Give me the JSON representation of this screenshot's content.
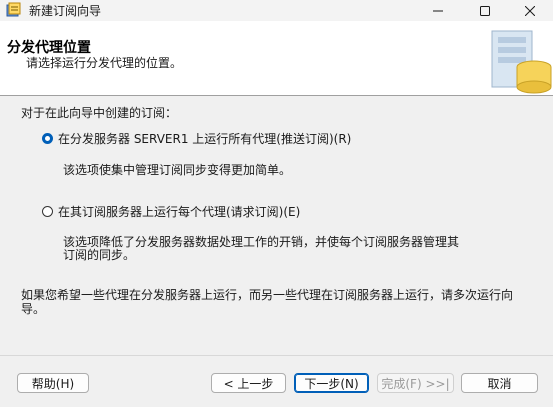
{
  "window": {
    "title": "新建订阅向导"
  },
  "header": {
    "title": "分发代理位置",
    "subtitle": "请选择运行分发代理的位置。"
  },
  "main": {
    "section_label": "对于在此向导中创建的订阅：",
    "options": [
      {
        "label": "在分发服务器 SERVER1 上运行所有代理(推送订阅)(R)",
        "checked": true,
        "description": "该选项使集中管理订阅同步变得更加简单。"
      },
      {
        "label": "在其订阅服务器上运行每个代理(请求订阅)(E)",
        "checked": false,
        "description_line1": "该选项降低了分发服务器数据处理工作的开销，并使每个订阅服务器管理其",
        "description_line2": "订阅的同步。"
      }
    ],
    "note_line1": "如果您希望一些代理在分发服务器上运行，而另一些代理在订阅服务器上运行，请多次运行向",
    "note_line2": "导。"
  },
  "footer": {
    "help_label": "帮助(H)",
    "back_label": "< 上一步",
    "next_label": "下一步(N)",
    "finish_label": "完成(F) >>|",
    "cancel_label": "取消"
  },
  "colors": {
    "accent": "#005fb8",
    "header_bg": "#ffffff",
    "body_bg": "#f0f0f0"
  }
}
